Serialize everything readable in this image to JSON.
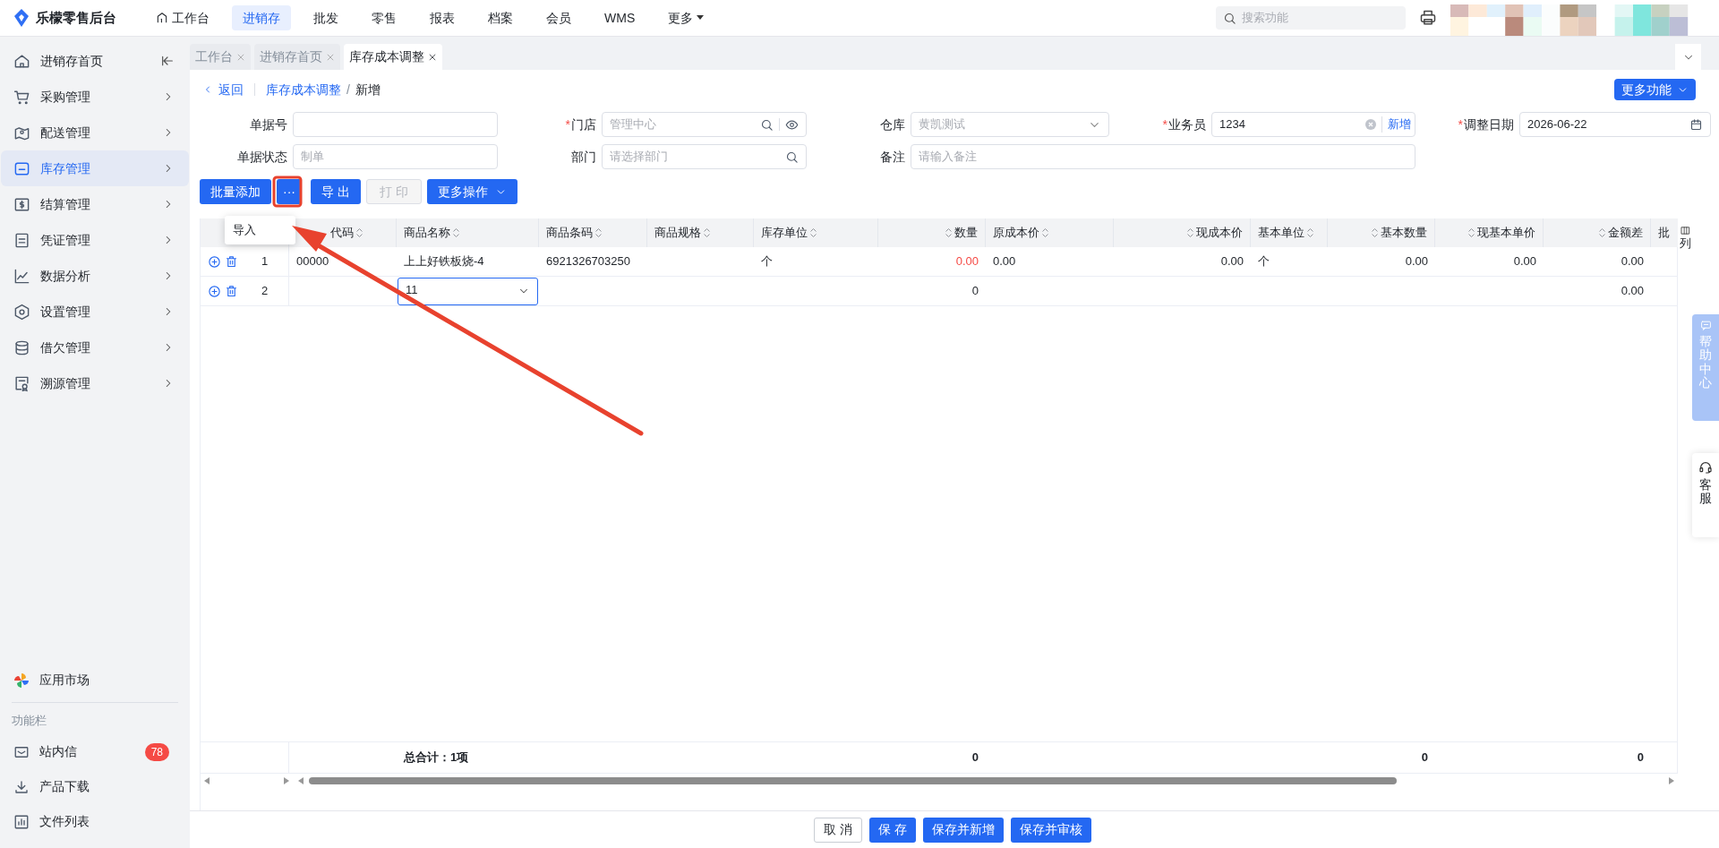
{
  "app": {
    "name": "乐檬零售后台"
  },
  "top_nav": [
    {
      "label": "工作台",
      "kind": "home",
      "selected": false
    },
    {
      "label": "进销存",
      "kind": "plain",
      "selected": true
    },
    {
      "label": "批发",
      "kind": "plain",
      "selected": false
    },
    {
      "label": "零售",
      "kind": "plain",
      "selected": false
    },
    {
      "label": "报表",
      "kind": "plain",
      "selected": false
    },
    {
      "label": "档案",
      "kind": "plain",
      "selected": false
    },
    {
      "label": "会员",
      "kind": "plain",
      "selected": false
    },
    {
      "label": "WMS",
      "kind": "plain",
      "selected": false
    },
    {
      "label": "更多",
      "kind": "dropdown",
      "selected": false
    }
  ],
  "search": {
    "placeholder": "搜索功能"
  },
  "tabs": [
    {
      "label": "工作台",
      "selected": false
    },
    {
      "label": "进销存首页",
      "selected": false
    },
    {
      "label": "库存成本调整",
      "selected": true
    }
  ],
  "sidebar": {
    "items": [
      {
        "label": "进销存首页",
        "kind": "collapse",
        "selected": false
      },
      {
        "label": "采购管理",
        "kind": "submenu",
        "selected": false
      },
      {
        "label": "配送管理",
        "kind": "submenu",
        "selected": false
      },
      {
        "label": "库存管理",
        "kind": "submenu",
        "selected": true
      },
      {
        "label": "结算管理",
        "kind": "submenu",
        "selected": false
      },
      {
        "label": "凭证管理",
        "kind": "submenu",
        "selected": false
      },
      {
        "label": "数据分析",
        "kind": "submenu",
        "selected": false
      },
      {
        "label": "设置管理",
        "kind": "submenu",
        "selected": false
      },
      {
        "label": "借欠管理",
        "kind": "submenu",
        "selected": false
      },
      {
        "label": "溯源管理",
        "kind": "submenu",
        "selected": false
      }
    ],
    "app_market": "应用市场",
    "section_title": "功能栏",
    "tools": [
      {
        "label": "站内信",
        "badge": "78"
      },
      {
        "label": "产品下载"
      },
      {
        "label": "文件列表"
      }
    ]
  },
  "breadcrumb": {
    "back": "返回",
    "items": [
      "库存成本调整",
      "新增"
    ],
    "separator": "/"
  },
  "more_functions": "更多功能",
  "form": {
    "fields": [
      {
        "label": "单据号",
        "kind": "text"
      },
      {
        "label": "门店",
        "mark": "*",
        "kind": "lookup",
        "placeholder": "管理中心"
      },
      {
        "label": "仓库",
        "kind": "select",
        "placeholder": "黄凯测试"
      },
      {
        "label": "业务员",
        "mark": "*",
        "kind": "clearable",
        "value": "1234",
        "link": "新增"
      },
      {
        "label": "调整日期",
        "mark": "*",
        "kind": "date",
        "value": "2026-06-22"
      },
      {
        "label": "单据状态",
        "kind": "text",
        "placeholder": "制单"
      },
      {
        "label": "部门",
        "kind": "search",
        "placeholder": "请选择部门"
      },
      {
        "label": "备注",
        "kind": "wide",
        "placeholder": "请输入备注"
      }
    ]
  },
  "toolbar": [
    {
      "label": "批量添加",
      "kind": "primary",
      "disabled": false
    },
    {
      "label": "···",
      "kind": "primary",
      "disabled": false
    },
    {
      "label": "导 出",
      "kind": "primary",
      "disabled": false
    },
    {
      "label": "打 印",
      "kind": "plain",
      "disabled": true
    },
    {
      "label": "更多操作",
      "kind": "dropdown",
      "disabled": false
    }
  ],
  "dropdown_menu": {
    "items": [
      "导入"
    ]
  },
  "table": {
    "columns": [
      {
        "label": "代码"
      },
      {
        "label": "商品名称"
      },
      {
        "label": "商品条码"
      },
      {
        "label": "商品规格"
      },
      {
        "label": "库存单位"
      },
      {
        "label": "数量"
      },
      {
        "label": "原成本价"
      },
      {
        "label": "现成本价"
      },
      {
        "label": "基本单位"
      },
      {
        "label": "基本数量"
      },
      {
        "label": "现基本单价"
      },
      {
        "label": "金额差"
      },
      {
        "label": "批"
      }
    ],
    "rows": [
      {
        "index": "1",
        "cells": [
          {
            "text": "00000"
          },
          {
            "text": "上上好铁板烧-4"
          },
          {
            "text": "6921326703250"
          },
          {},
          {
            "text": "个"
          },
          {
            "text": "0.00",
            "invalid": true
          },
          {
            "text": "0.00"
          },
          {
            "text": "0.00"
          },
          {
            "text": "个"
          },
          {
            "text": "0.00"
          },
          {
            "text": "0.00"
          },
          {
            "text": "0.00"
          },
          {}
        ]
      },
      {
        "index": "2",
        "cells": [
          {},
          {
            "kind": "select",
            "text": "11"
          },
          {},
          {},
          {},
          {
            "text": "0",
            "invalid": false
          },
          {},
          {},
          {},
          {},
          {},
          {
            "text": "0.00"
          },
          {}
        ]
      }
    ],
    "totals": {
      "label": "总合计：1项",
      "quantity": "0",
      "base_quantity": "0",
      "amount_difference": "0"
    },
    "column_settings": "列"
  },
  "footer_buttons": [
    {
      "label": "取 消",
      "kind": "default"
    },
    {
      "label": "保 存",
      "kind": "primary"
    },
    {
      "label": "保存并新增",
      "kind": "primary"
    },
    {
      "label": "保存并审核",
      "kind": "primary"
    }
  ],
  "help_center": "帮助中心",
  "customer_service": "客服"
}
